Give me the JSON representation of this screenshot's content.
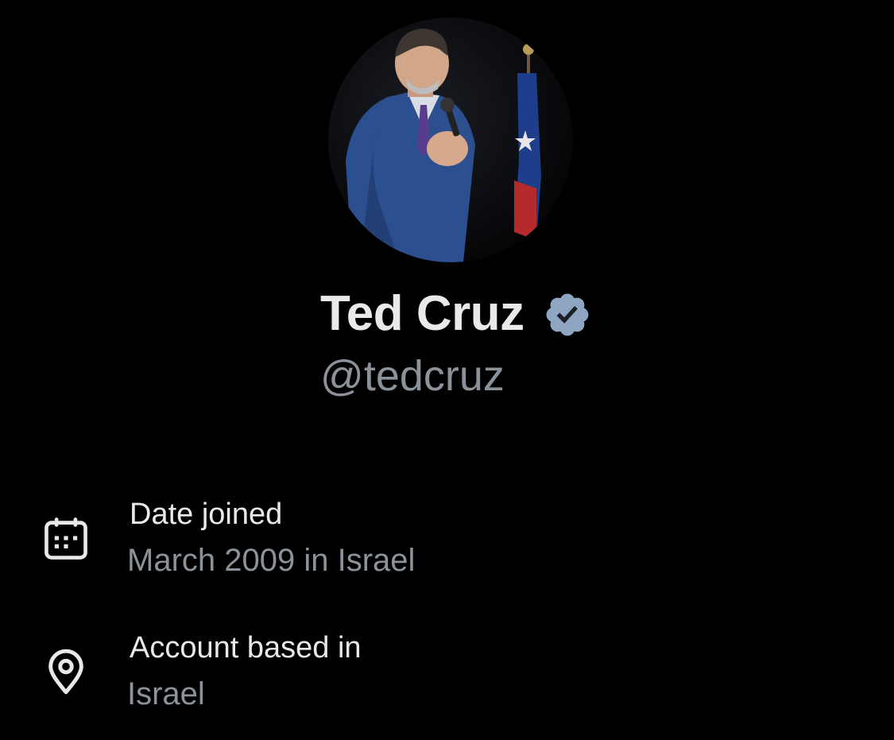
{
  "profile": {
    "display_name": "Ted Cruz",
    "handle": "@tedcruz",
    "verified": true,
    "avatar_icon": "avatar-photo",
    "verified_icon": "verified-badge-icon"
  },
  "about": {
    "date_joined": {
      "label": "Date joined",
      "value": "March 2009 in Israel",
      "icon": "calendar-icon"
    },
    "account_based_in": {
      "label": "Account based in",
      "value": "Israel",
      "icon": "location-pin-icon"
    }
  },
  "colors": {
    "background": "#000000",
    "primary_text": "#e7e9ea",
    "secondary_text": "#8b9299",
    "verified_badge": "#8fa6c2"
  }
}
